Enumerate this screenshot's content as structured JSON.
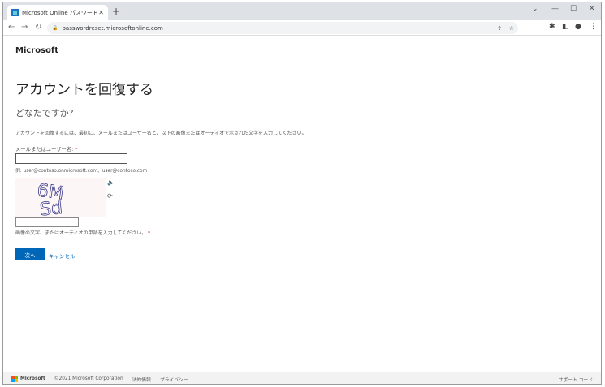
{
  "browser": {
    "tab_title": "Microsoft Online パスワード リセット",
    "url": "passwordreset.microsoftonline.com"
  },
  "page": {
    "brand": "Microsoft",
    "title": "アカウントを回復する",
    "subtitle": "どなたですか?",
    "description": "アカウントを回復するには、最初に、メールまたはユーザー名と、以下の画像またはオーディオで示された文字を入力してください。",
    "email_label": "メールまたはユーザー名:",
    "required_mark": "*",
    "email_value": "",
    "example": "例: user@contoso.onmicrosoft.com、user@contoso.com",
    "captcha_text": [
      "6M",
      "Sd"
    ],
    "captcha_value": "",
    "captcha_hint": "画像の文字、またはオーディオの単語を入力してください。",
    "next_label": "次へ",
    "cancel_label": "キャンセル"
  },
  "footer": {
    "brand": "Microsoft",
    "copyright": "©2021 Microsoft Corporation",
    "legal": "法的情報",
    "privacy": "プライバシー",
    "support_code": "サポート コード"
  },
  "colors": {
    "accent": "#0067b8",
    "ms_logo": [
      "#f25022",
      "#7fba00",
      "#00a4ef",
      "#ffb900"
    ]
  }
}
